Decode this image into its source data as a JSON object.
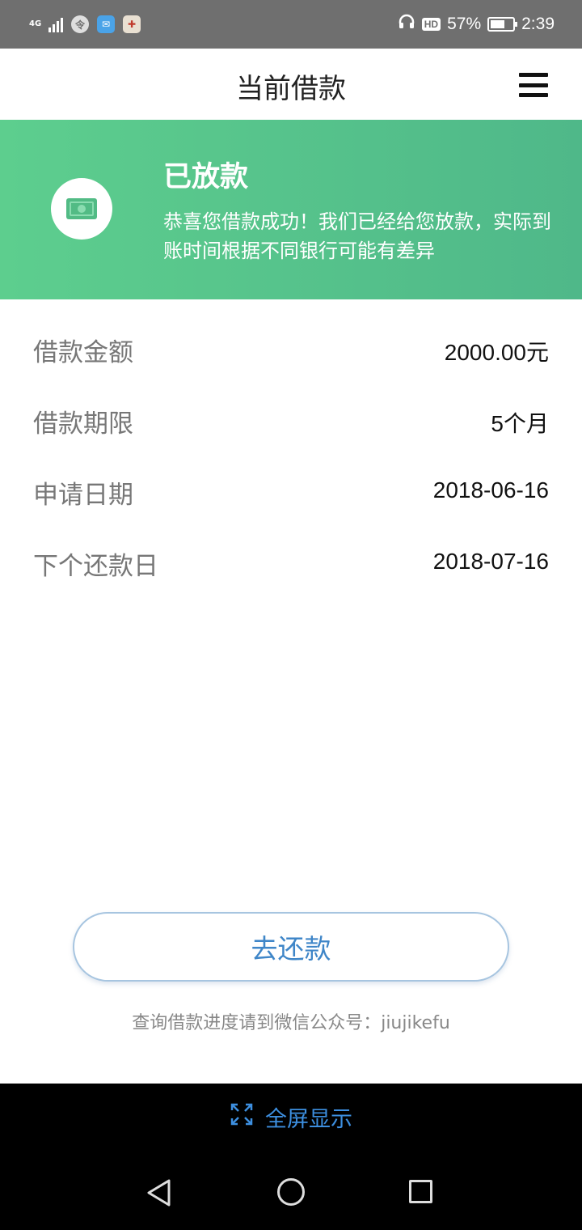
{
  "status_bar": {
    "network": "4G",
    "battery_percent": "57%",
    "time": "2:39",
    "hd_label": "HD"
  },
  "header": {
    "title": "当前借款"
  },
  "banner": {
    "title": "已放款",
    "description": "恭喜您借款成功！我们已经给您放款，实际到账时间根据不同银行可能有差异"
  },
  "loan_info": [
    {
      "label": "借款金额",
      "value": "2000.00元"
    },
    {
      "label": "借款期限",
      "value": "5个月"
    },
    {
      "label": "申请日期",
      "value": "2018-06-16"
    },
    {
      "label": "下个还款日",
      "value": "2018-07-16"
    }
  ],
  "actions": {
    "repay_label": "去还款"
  },
  "footer": {
    "note": "查询借款进度请到微信公众号：jiujikefu"
  },
  "bottom_bar": {
    "fullscreen_label": "全屏显示"
  },
  "colors": {
    "banner_green": "#5dce8e",
    "accent_blue": "#3f86c8"
  }
}
